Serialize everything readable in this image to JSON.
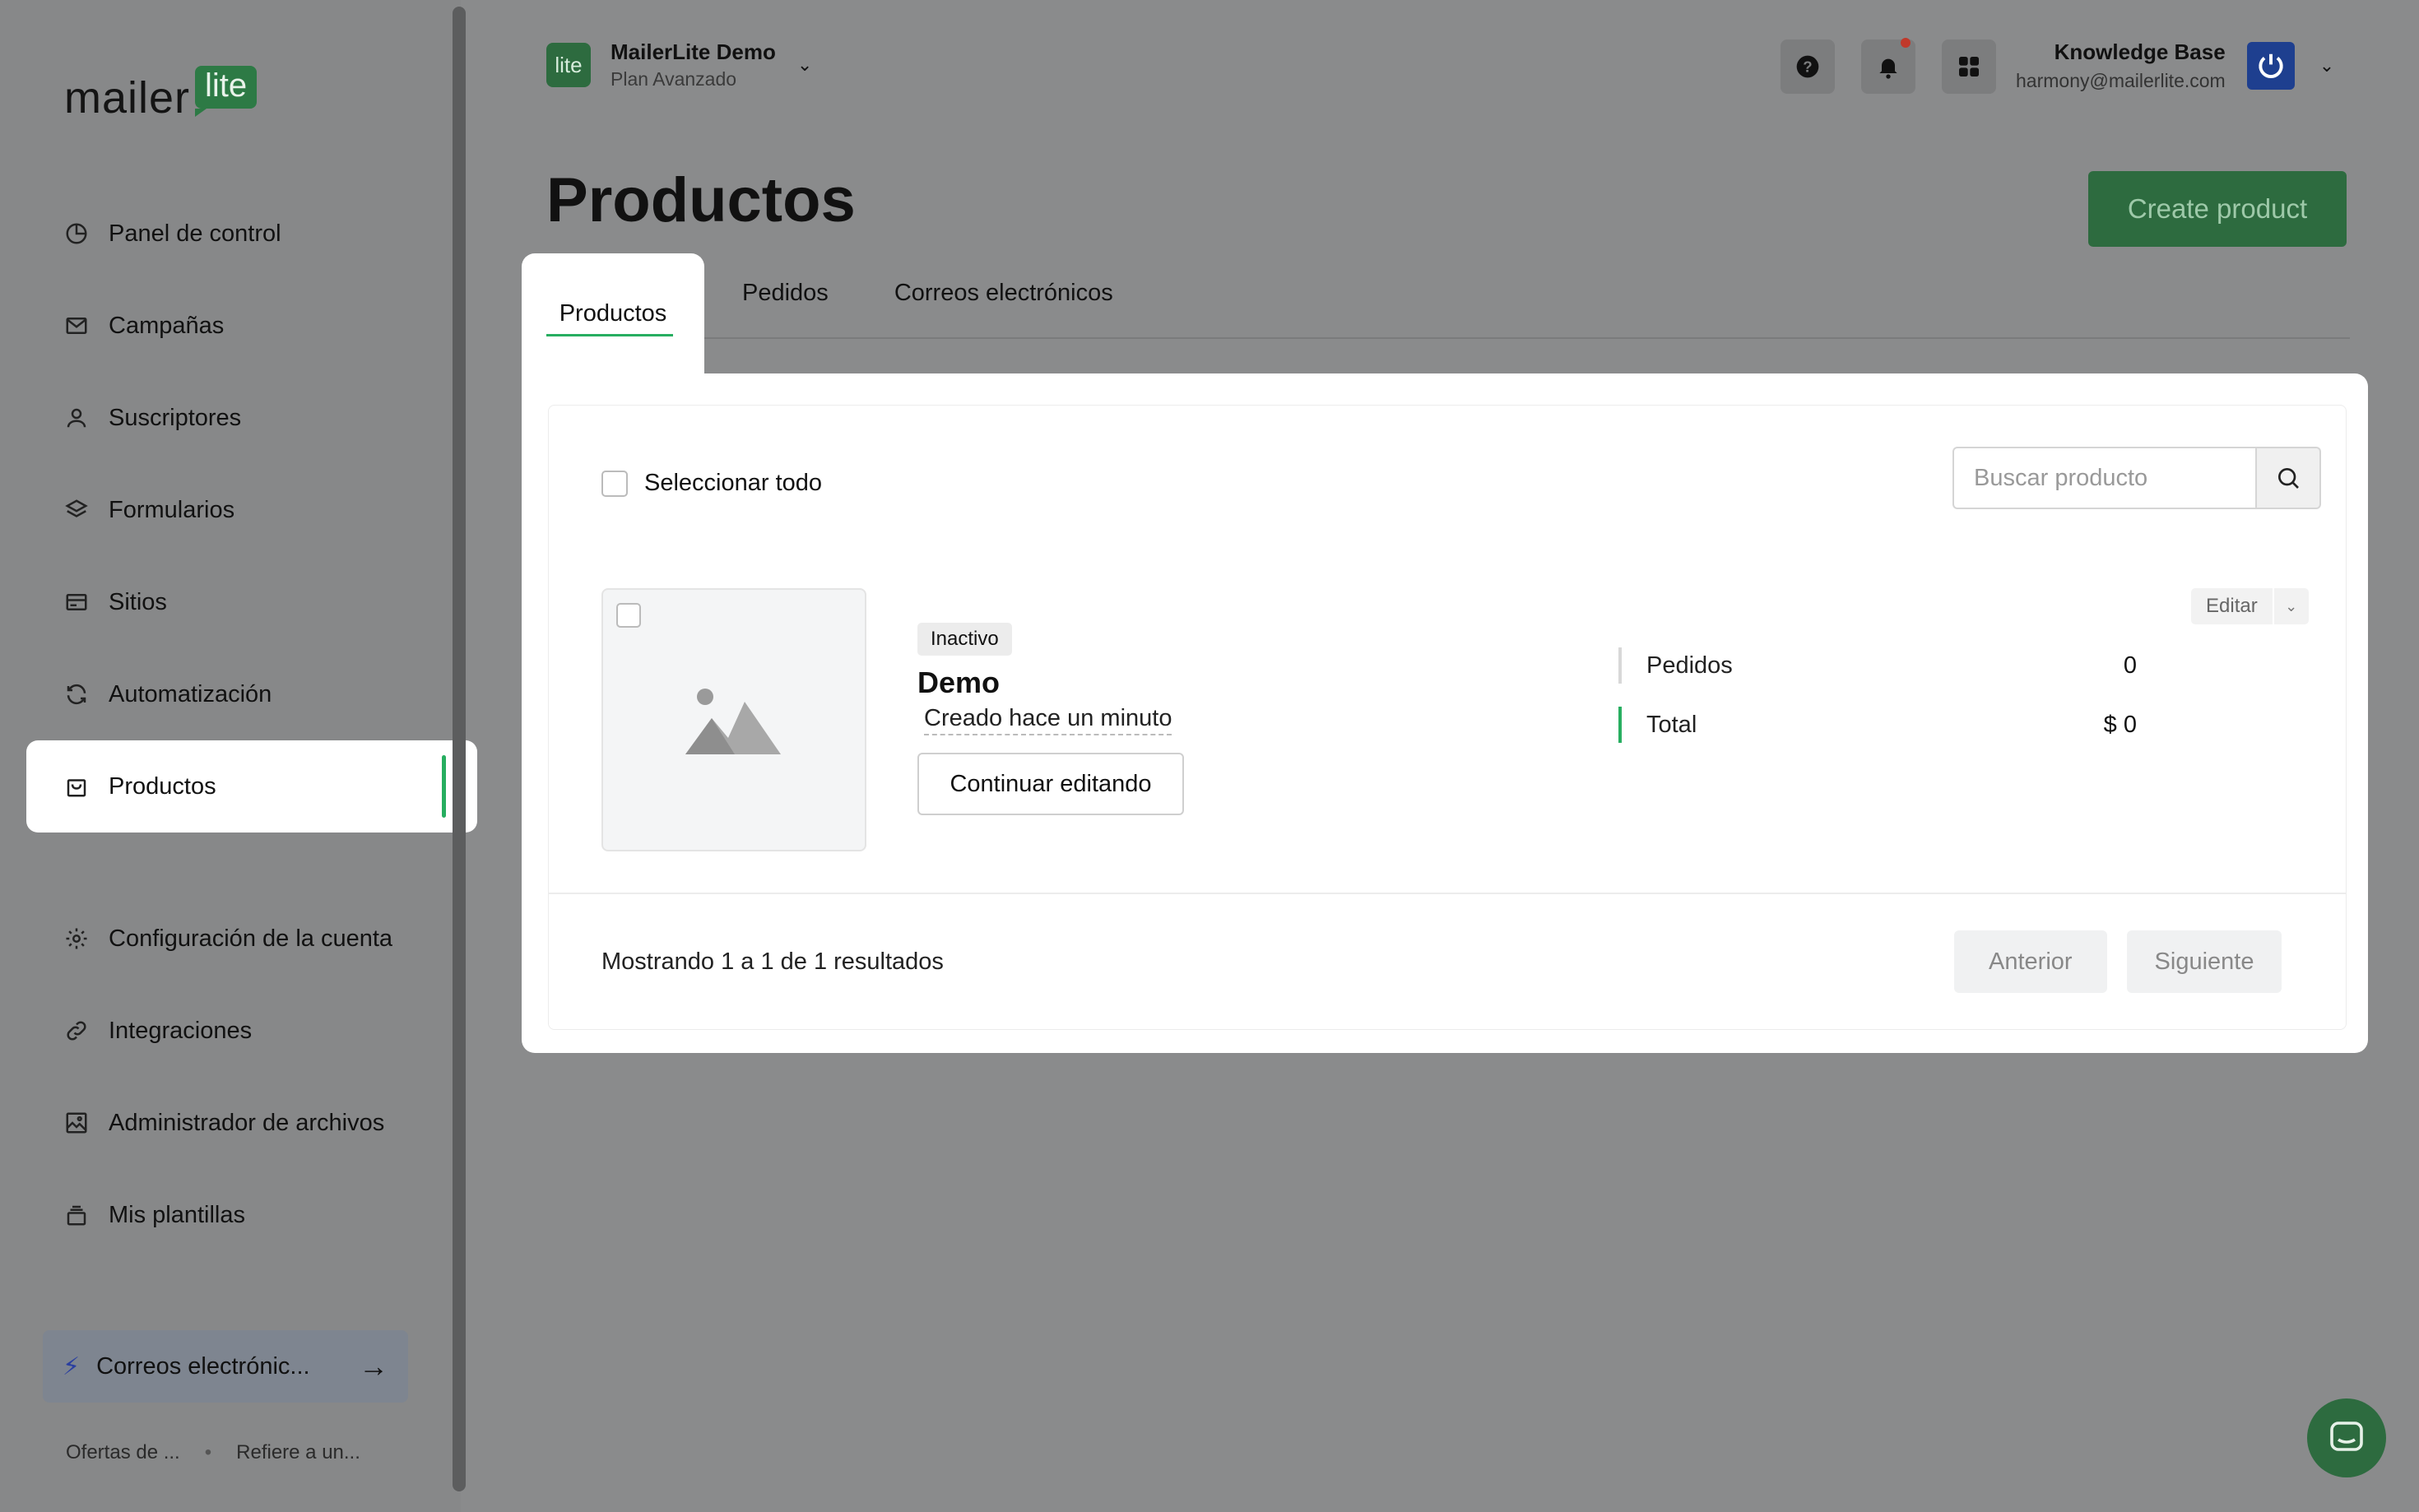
{
  "sidebar": {
    "logo_main": "mailer",
    "logo_badge": "lite",
    "items": [
      {
        "label": "Panel de control",
        "icon": "chart-pie-icon"
      },
      {
        "label": "Campañas",
        "icon": "envelope-icon"
      },
      {
        "label": "Suscriptores",
        "icon": "user-icon"
      },
      {
        "label": "Formularios",
        "icon": "layers-icon"
      },
      {
        "label": "Sitios",
        "icon": "browser-icon"
      },
      {
        "label": "Automatización",
        "icon": "refresh-icon"
      },
      {
        "label": "Productos",
        "icon": "shopping-bag-icon",
        "active": true
      }
    ],
    "items_secondary": [
      {
        "label": "Configuración de la cuenta",
        "icon": "gear-icon"
      },
      {
        "label": "Integraciones",
        "icon": "link-icon"
      },
      {
        "label": "Administrador de archivos",
        "icon": "image-icon"
      },
      {
        "label": "Mis plantillas",
        "icon": "stack-icon"
      }
    ],
    "promo_label": "Correos electrónic...",
    "footer_links": [
      "Ofertas de ...",
      "Refiere a un..."
    ]
  },
  "header": {
    "account_badge": "lite",
    "account_name": "MailerLite Demo",
    "account_plan": "Plan Avanzado",
    "user_name": "Knowledge Base",
    "user_email": "harmony@mailerlite.com"
  },
  "page": {
    "title": "Productos",
    "create_button": "Create product",
    "tabs": [
      {
        "label": "Productos",
        "active": true
      },
      {
        "label": "Pedidos"
      },
      {
        "label": "Correos electrónicos"
      }
    ]
  },
  "list": {
    "select_all": "Seleccionar todo",
    "search_placeholder": "Buscar producto",
    "product": {
      "status": "Inactivo",
      "name": "Demo",
      "created": "Creado hace un minuto",
      "continue_button": "Continuar editando",
      "edit_button": "Editar",
      "stats": [
        {
          "label": "Pedidos",
          "value": "0"
        },
        {
          "label": "Total",
          "value": "$ 0"
        }
      ]
    },
    "results_text": "Mostrando 1 a 1 de 1 resultados",
    "prev_button": "Anterior",
    "next_button": "Siguiente"
  },
  "colors": {
    "brand_green": "#2d6b3f",
    "active_indicator": "#27ae60",
    "notification_dot": "#c0392b",
    "avatar_blue": "#1e3f8f"
  }
}
